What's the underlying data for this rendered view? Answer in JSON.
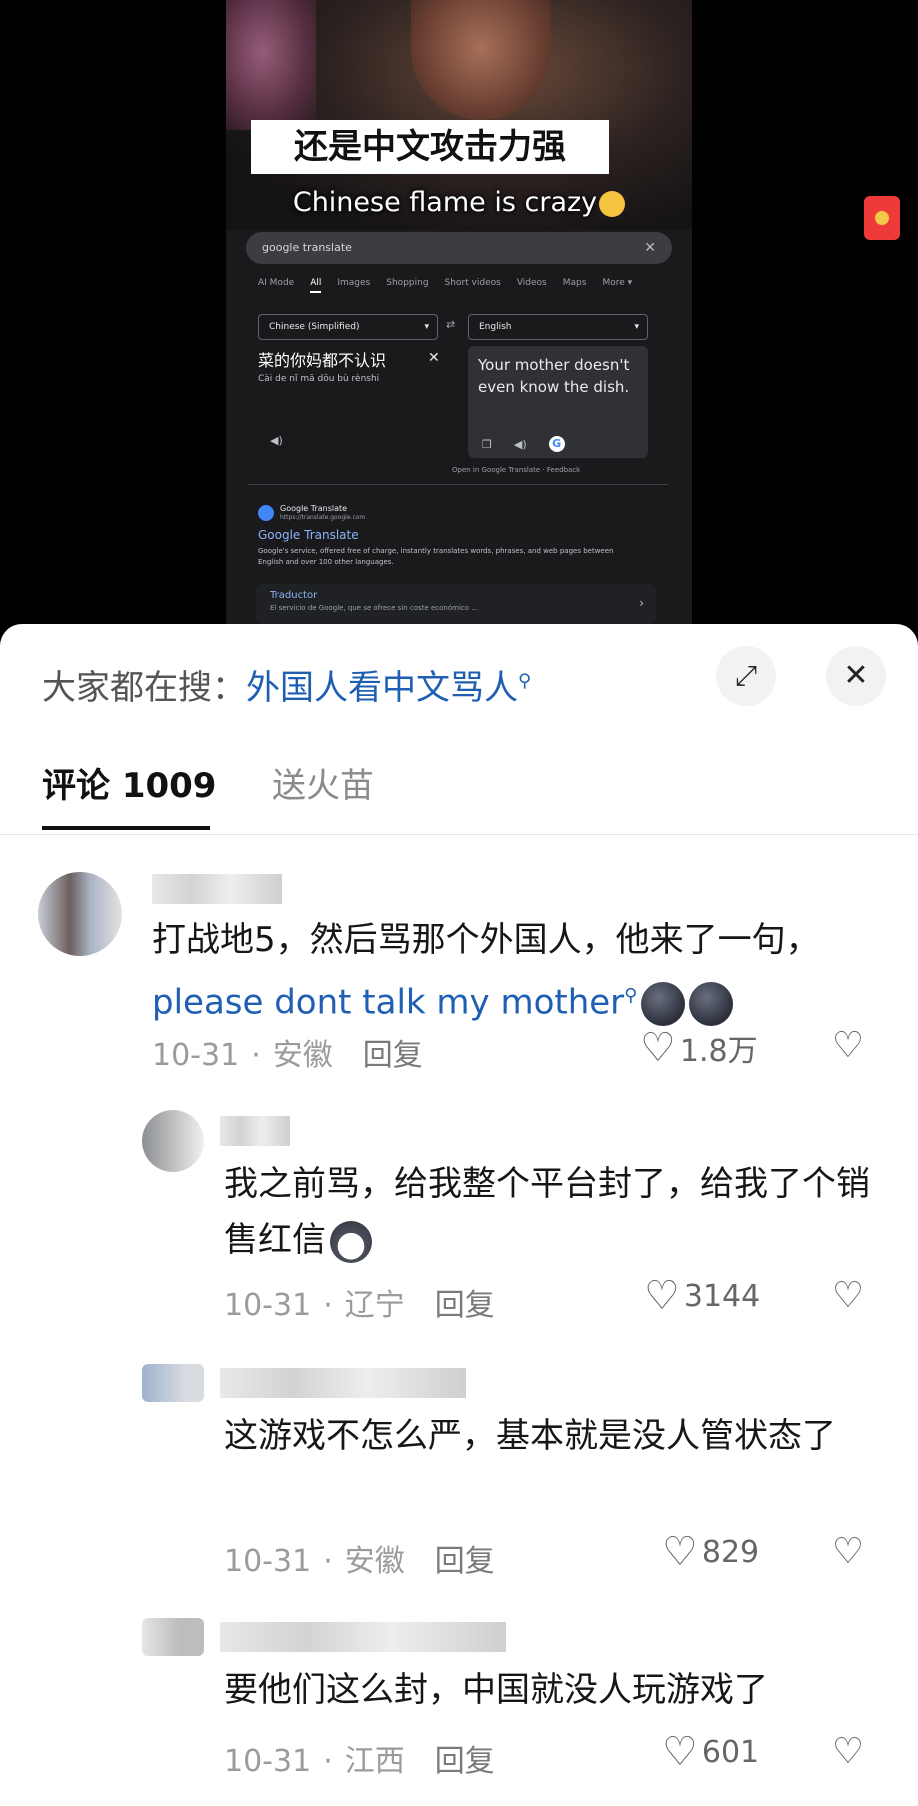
{
  "video": {
    "overlay_cn": "还是中文攻击力强",
    "overlay_en": "Chinese flame is crazy",
    "search_query": "google translate",
    "search_tabs": [
      "AI Mode",
      "All",
      "Images",
      "Shopping",
      "Short videos",
      "Videos",
      "Maps",
      "More ▾"
    ],
    "source_lang": "Chinese (Simplified)",
    "target_lang": "English",
    "source_text": "菜的你妈都不认识",
    "source_pinyin": "Cài de nǐ mā dōu bù rènshi",
    "translation": "Your mother doesn't even know the dish.",
    "footer": "Open in Google Translate  ·  Feedback",
    "result_site": "Google Translate",
    "result_url": "https://translate.google.com",
    "result_title": "Google Translate",
    "result_desc": "Google's service, offered free of charge, instantly translates words, phrases, and web pages between English and over 100 other languages.",
    "result2_title": "Traductor",
    "result2_desc": "El servicio de Google, que se ofrece sin coste económico ..."
  },
  "sheet": {
    "search_label": "大家都在搜：",
    "search_keyword": "外国人看中文骂人",
    "tab_comments": "评论 1009",
    "tab_fire": "送火苗"
  },
  "comments": [
    {
      "text_cn": "打战地5，然后骂那个外国人，他来了一句，",
      "text_link": "please dont talk my mother",
      "date": "10-31",
      "location": "安徽",
      "reply": "回复",
      "likes": "1.8万"
    },
    {
      "text": "我之前骂，给我整个平台封了，给我了个销售红信",
      "date": "10-31",
      "location": "辽宁",
      "reply": "回复",
      "likes": "3144"
    },
    {
      "text": "这游戏不怎么严，基本就是没人管状态了",
      "date": "10-31",
      "location": "安徽",
      "reply": "回复",
      "likes": "829"
    },
    {
      "text": "要他们这么封，中国就没人玩游戏了",
      "date": "10-31",
      "location": "江西",
      "reply": "回复",
      "likes": "601"
    }
  ]
}
